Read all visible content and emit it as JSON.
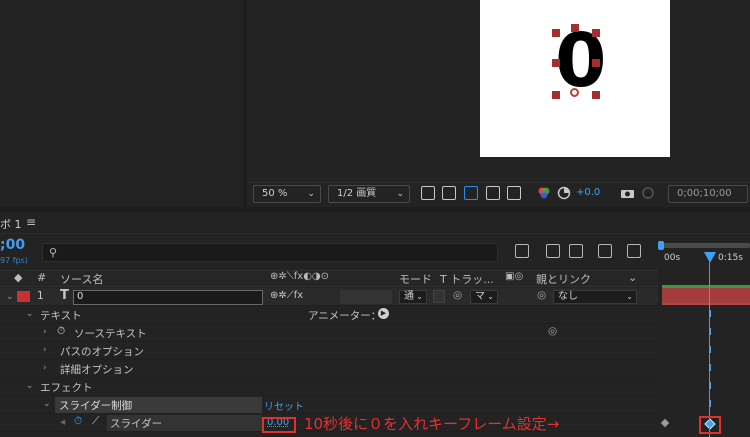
{
  "viewer": {
    "zoom": "50 %",
    "resolution": "1/2 画質",
    "exposure": "+0.0",
    "timecode": "0;00;10;00",
    "preview_text": "0"
  },
  "timeline": {
    "tab_label": "ボ 1",
    "current_time": ";00",
    "fps": "97 fps)",
    "ruler_start": "00s",
    "ruler_15": "0:15s"
  },
  "columns": {
    "num": "#",
    "source_name": "ソース名",
    "mode": "モード",
    "track": "T トラッ...",
    "parent": "親とリンク"
  },
  "layer": {
    "index": "1",
    "type_glyph": "T",
    "name": "0",
    "mode": "通",
    "track": "マ",
    "parent": "なし"
  },
  "tree": {
    "text": "テキスト",
    "animator": "アニメーター：",
    "source_text": "ソーステキスト",
    "path_options": "パスのオプション",
    "more_options": "詳細オプション",
    "effects": "エフェクト",
    "slider_control": "スライダー制御",
    "reset": "リセット",
    "slider": "スライダー",
    "slider_value": "0.00"
  },
  "annotation": "10秒後に０を入れキーフレーム設定→",
  "colors": {
    "accent_blue": "#3f9ff5",
    "label_red": "#c83232",
    "annotation_red": "#e0302e",
    "layer_bar": "#a33d3d"
  }
}
